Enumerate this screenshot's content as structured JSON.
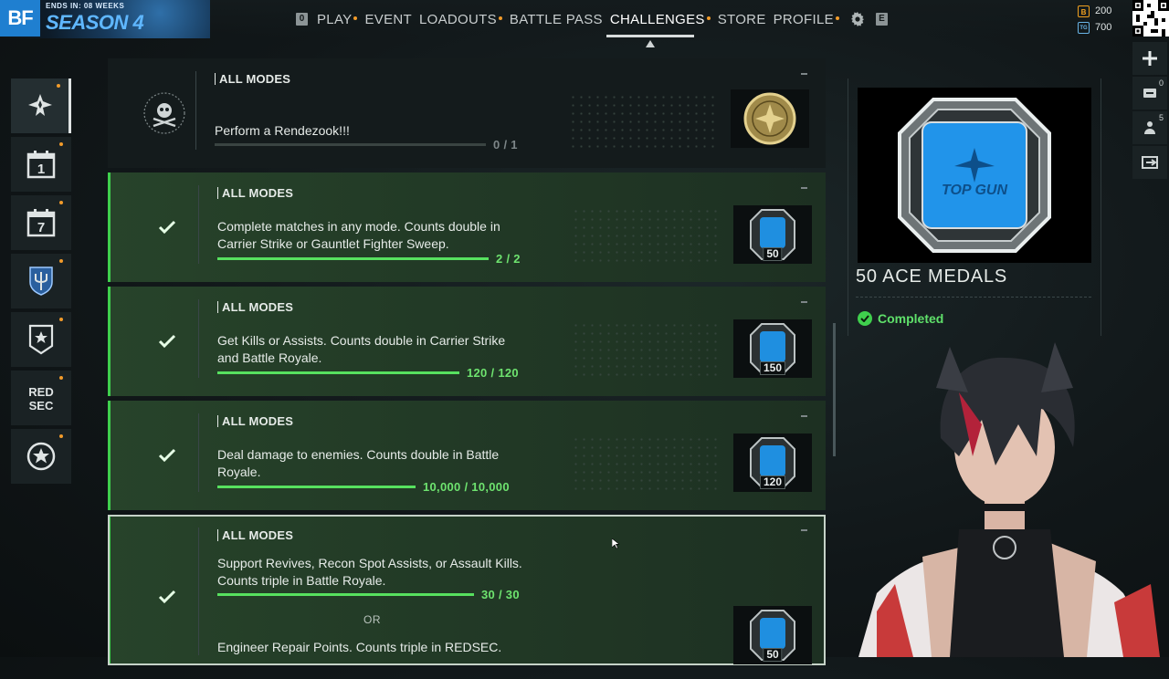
{
  "header": {
    "logo_short": "BF",
    "ends_in": "ENDS IN: 08 WEEKS",
    "season": "SEASON 4",
    "left_key": "0",
    "right_key": "E",
    "nav": [
      {
        "label": "PLAY",
        "dot": true,
        "active": false
      },
      {
        "label": "EVENT",
        "dot": false,
        "active": false
      },
      {
        "label": "LOADOUTS",
        "dot": true,
        "active": false
      },
      {
        "label": "BATTLE PASS",
        "dot": false,
        "active": false
      },
      {
        "label": "CHALLENGES",
        "dot": true,
        "active": true
      },
      {
        "label": "STORE",
        "dot": false,
        "active": false
      },
      {
        "label": "PROFILE",
        "dot": true,
        "active": false
      }
    ],
    "currency": [
      {
        "icon_label": "B",
        "value": "200",
        "color": "#f0a020"
      },
      {
        "icon_label": "TG",
        "value": "700",
        "color": "#69b4e6"
      }
    ]
  },
  "sidebar": {
    "items": [
      {
        "icon": "jet-emblem-icon",
        "active": true
      },
      {
        "icon": "calendar-daily-icon",
        "text": "1"
      },
      {
        "icon": "calendar-weekly-icon",
        "text": "7"
      },
      {
        "icon": "trident-shield-icon"
      },
      {
        "icon": "rank-star-badge-icon"
      },
      {
        "icon": "redsec-icon",
        "text": "RED SEC"
      },
      {
        "icon": "circle-star-icon"
      }
    ]
  },
  "challenges": [
    {
      "mode": "ALL MODES",
      "desc": "Perform a Rendezook!!!",
      "progress": "0 / 1",
      "fraction": 0.0,
      "completed": false,
      "reward_value": ""
    },
    {
      "mode": "ALL MODES",
      "desc": "Complete matches in any mode. Counts double in Carrier Strike or Gauntlet Fighter Sweep.",
      "progress": "2 / 2",
      "fraction": 1.0,
      "completed": true,
      "reward_value": "50"
    },
    {
      "mode": "ALL MODES",
      "desc": "Get Kills or Assists. Counts double in Carrier Strike and Battle Royale.",
      "progress": "120 / 120",
      "fraction": 1.0,
      "completed": true,
      "reward_value": "150"
    },
    {
      "mode": "ALL MODES",
      "desc": "Deal damage to enemies. Counts double in Battle Royale.",
      "progress": "10,000 / 10,000",
      "fraction": 1.0,
      "completed": true,
      "reward_value": "120"
    },
    {
      "mode": "ALL MODES",
      "desc": "Support Revives, Recon Spot Assists, or Assault Kills. Counts triple in Battle Royale.",
      "progress": "30 / 30",
      "fraction": 1.0,
      "completed": true,
      "or_label": "OR",
      "desc2": "Engineer Repair Points. Counts triple in REDSEC.",
      "reward_value": "50"
    }
  ],
  "detail": {
    "title": "50 ACE MEDALS",
    "status": "Completed",
    "badge_text": "TOP GUN"
  },
  "right_column": [
    {
      "icon": "plus-icon",
      "count": ""
    },
    {
      "icon": "minus-card-icon",
      "count": "0"
    },
    {
      "icon": "squad-icon",
      "count": "5"
    },
    {
      "icon": "exit-icon",
      "count": ""
    }
  ]
}
